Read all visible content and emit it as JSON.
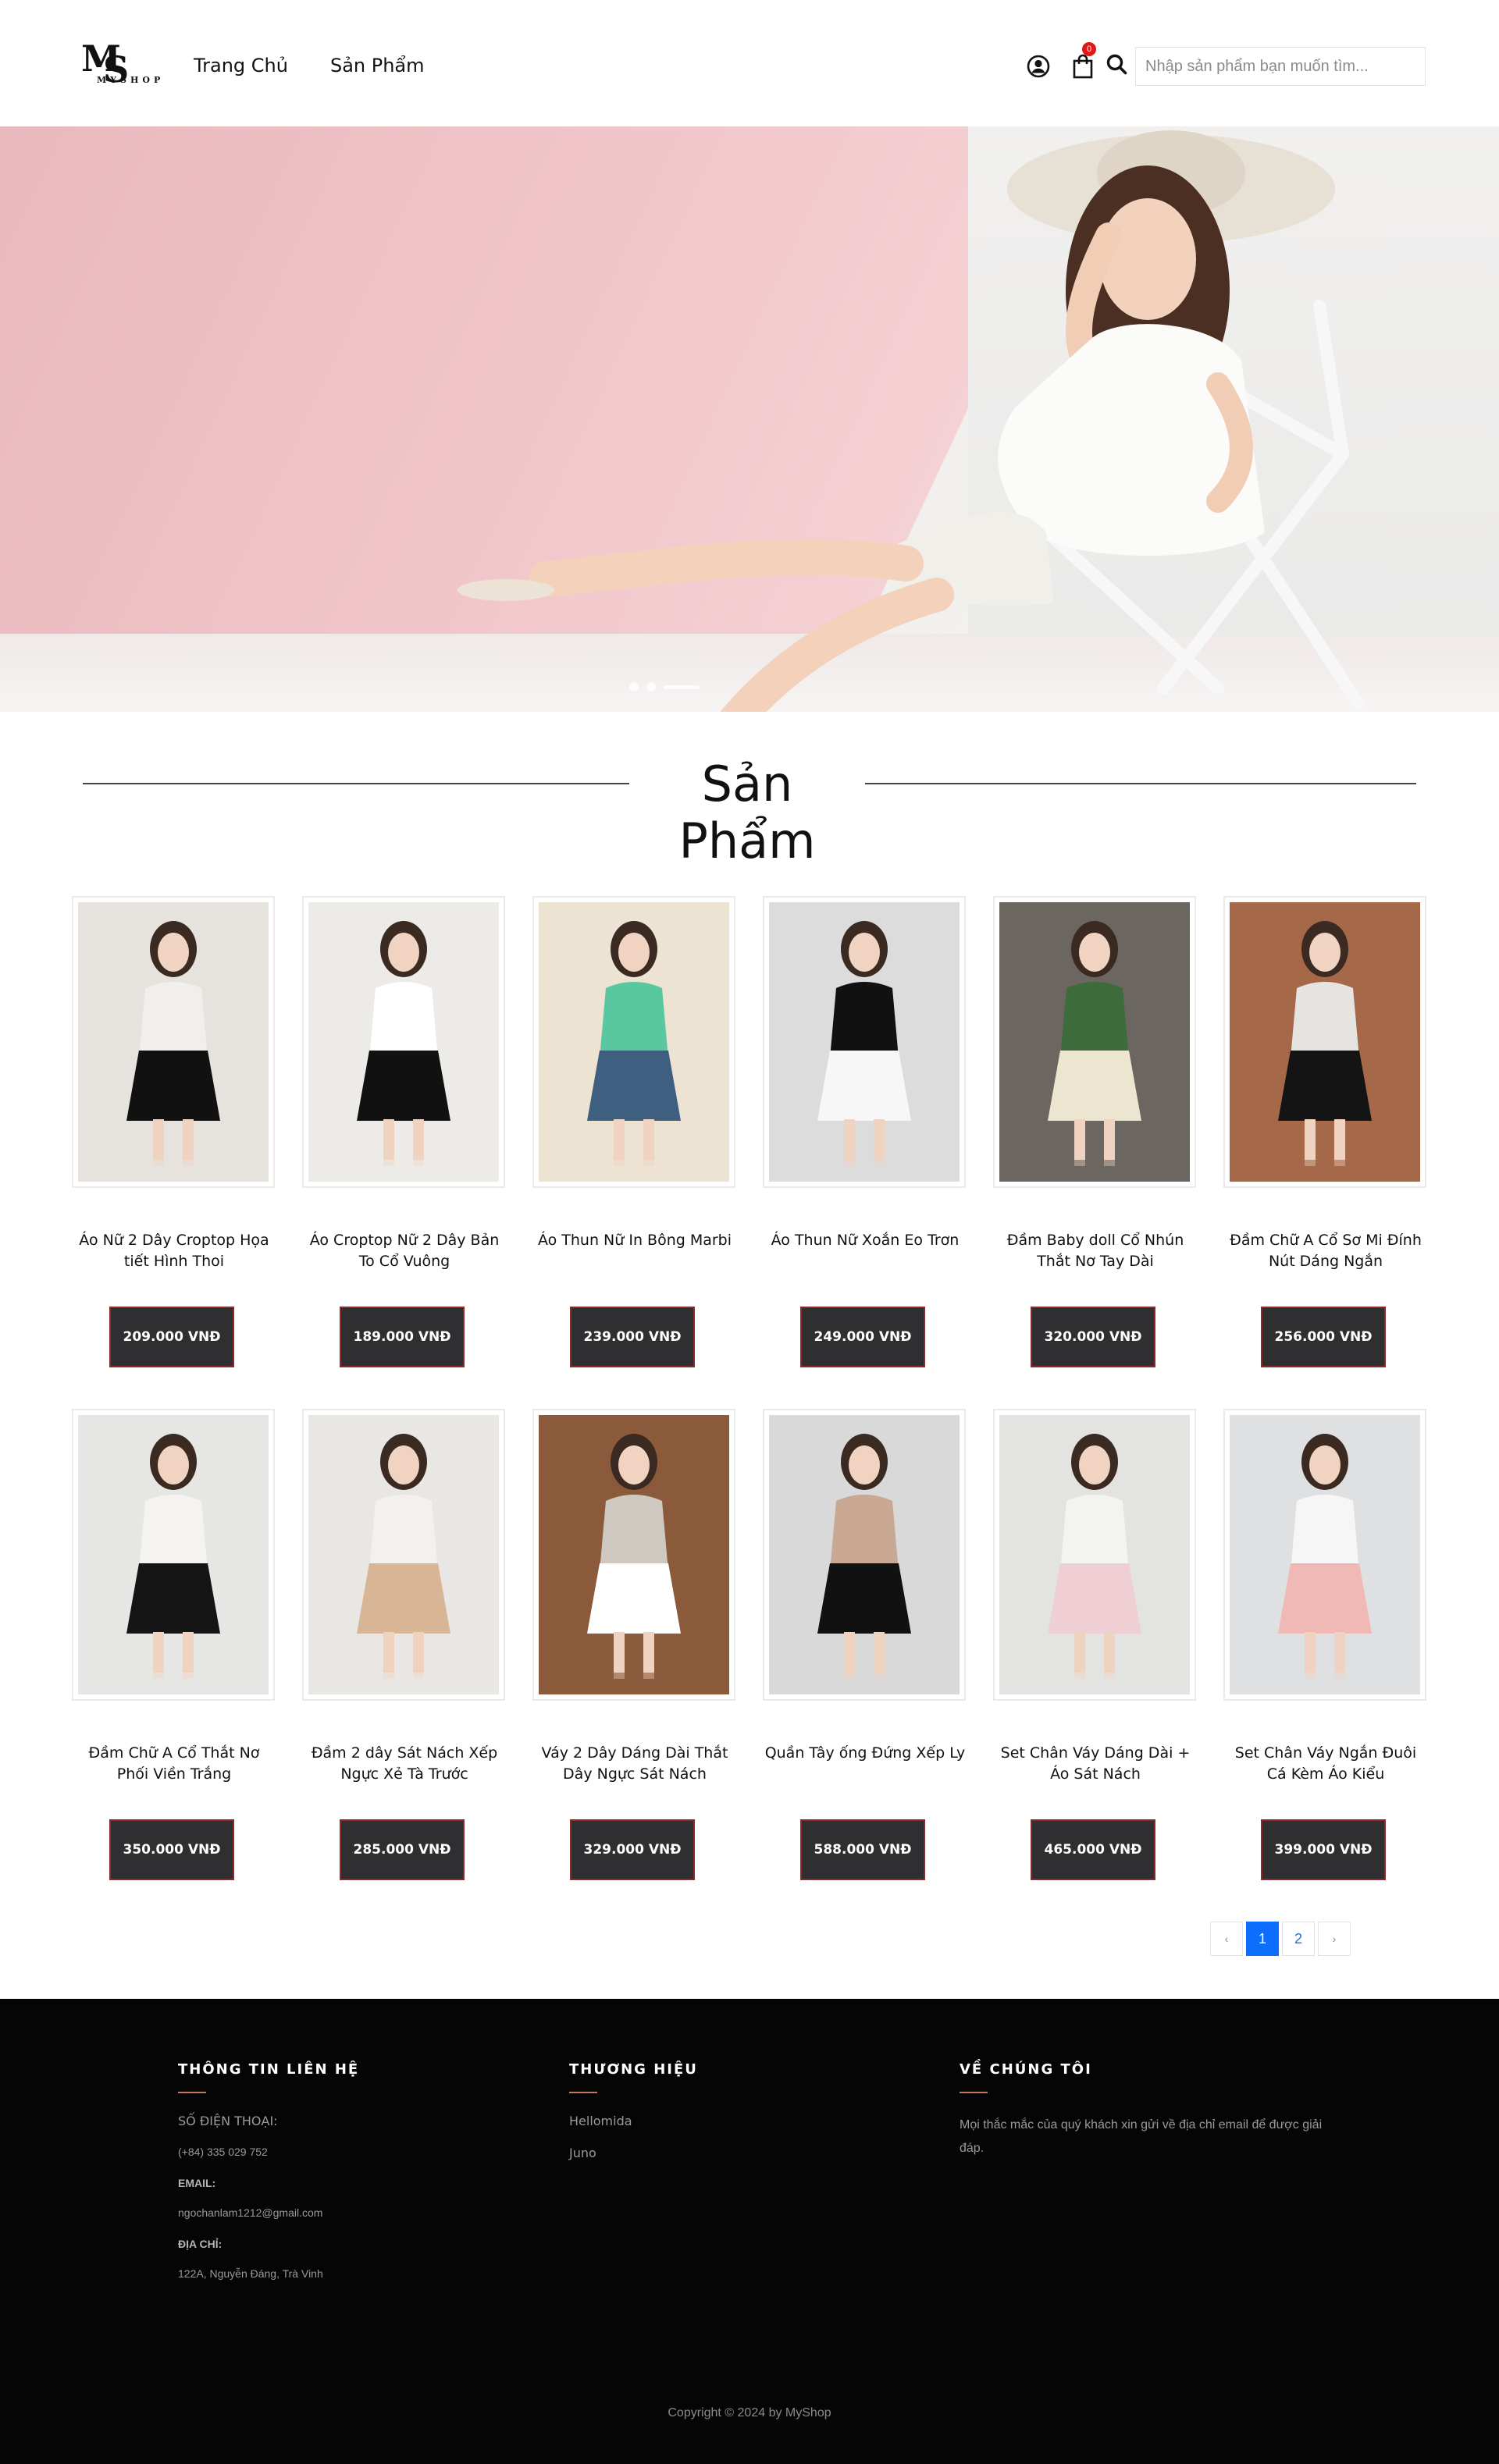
{
  "header": {
    "logo": {
      "letters_m": "M",
      "letters_s": "S",
      "sub": "MYSHOP"
    },
    "nav": [
      {
        "label": "Trang Chủ"
      },
      {
        "label": "Sản Phẩm"
      }
    ],
    "cart_count": "0",
    "search_placeholder": "Nhập sản phẩm bạn muốn tìm...",
    "icons": {
      "user": "user-circle-icon",
      "cart": "shopping-bag-icon",
      "search": "search-icon"
    }
  },
  "hero": {
    "slides": 3,
    "active_slide": 1
  },
  "section": {
    "title": "Sản Phẩm"
  },
  "products": [
    {
      "name": "Áo Nữ 2 Dây Croptop Họa tiết Hình Thoi",
      "price": "209.000 VNĐ",
      "colors": [
        "#e6e2dd",
        "#111111",
        "#f0efec"
      ]
    },
    {
      "name": "Áo Croptop Nữ 2 Dây Bản To Cổ Vuông",
      "price": "189.000 VNĐ",
      "colors": [
        "#ecebe8",
        "#111111",
        "#ffffff"
      ]
    },
    {
      "name": "Áo Thun Nữ In Bông Marbi",
      "price": "239.000 VNĐ",
      "colors": [
        "#ece3d2",
        "#3f5f80",
        "#59c7a0"
      ]
    },
    {
      "name": "Áo Thun Nữ Xoắn Eo Trơn",
      "price": "249.000 VNĐ",
      "colors": [
        "#dcdcdc",
        "#f7f7f7",
        "#111111"
      ]
    },
    {
      "name": "Đầm Baby doll Cổ Nhún Thắt Nơ Tay Dài",
      "price": "320.000 VNĐ",
      "colors": [
        "#6c6660",
        "#ece5cf",
        "#3e6b3c"
      ]
    },
    {
      "name": "Đầm Chữ A Cổ Sơ Mi Đính Nút Dáng Ngắn",
      "price": "256.000 VNĐ",
      "colors": [
        "#a5694a",
        "#141414",
        "#e6e4e0"
      ]
    },
    {
      "name": "Đầm Chữ A Cổ Thắt Nơ Phối Viền Trắng",
      "price": "350.000 VNĐ",
      "colors": [
        "#e6e6e4",
        "#151515",
        "#f4f3ef"
      ]
    },
    {
      "name": "Đầm 2 dây Sát Nách Xếp Ngực Xẻ Tà Trước",
      "price": "285.000 VNĐ",
      "colors": [
        "#e9e7e4",
        "#d8b594",
        "#f3f1ee"
      ]
    },
    {
      "name": "Váy 2 Dây Dáng Dài Thắt Dây Ngực Sát Nách",
      "price": "329.000 VNĐ",
      "colors": [
        "#8a5a3a",
        "#ffffff",
        "#cfc8c0"
      ]
    },
    {
      "name": "Quần Tây ống Đứng Xếp Ly",
      "price": "588.000 VNĐ",
      "colors": [
        "#d9d9d9",
        "#111111",
        "#c9a993"
      ]
    },
    {
      "name": "Set Chân Váy Dáng Dài + Áo Sát Nách",
      "price": "465.000 VNĐ",
      "colors": [
        "#e3e3e2",
        "#efcfd4",
        "#f3f3f2"
      ]
    },
    {
      "name": "Set Chân Váy Ngắn Đuôi Cá Kèm Áo Kiểu",
      "price": "399.000 VNĐ",
      "colors": [
        "#dfe0e2",
        "#f1b9b6",
        "#f6f6f6"
      ]
    }
  ],
  "pagination": {
    "prev": "‹",
    "pages": [
      "1",
      "2"
    ],
    "active": "1",
    "next": "›"
  },
  "footer": {
    "contact": {
      "title": "THÔNG TIN LIÊN HỆ",
      "phone_label": "SỐ ĐIỆN THOẠI:",
      "phone": "(+84) 335 029 752",
      "email_label": "EMAIL:",
      "email": "ngochanlam1212@gmail.com",
      "address_label": "ĐỊA CHỈ:",
      "address": "122A, Nguyễn Đáng, Trà Vinh"
    },
    "brands": {
      "title": "THƯƠNG HIỆU",
      "items": [
        "Hellomida",
        "Juno"
      ]
    },
    "about": {
      "title": "VỀ CHÚNG TÔI",
      "text": "Mọi thắc mắc của quý khách xin gửi về địa chỉ email để được giải đáp."
    },
    "copyright": "Copyright © 2024 by MyShop"
  },
  "colors": {
    "price_bg": "#2f2f31",
    "price_border": "#8a2a2a",
    "footer_bg": "#050505",
    "accent_under": "#c27a5a",
    "page_active": "#0d6efd",
    "badge": "#e01818"
  }
}
